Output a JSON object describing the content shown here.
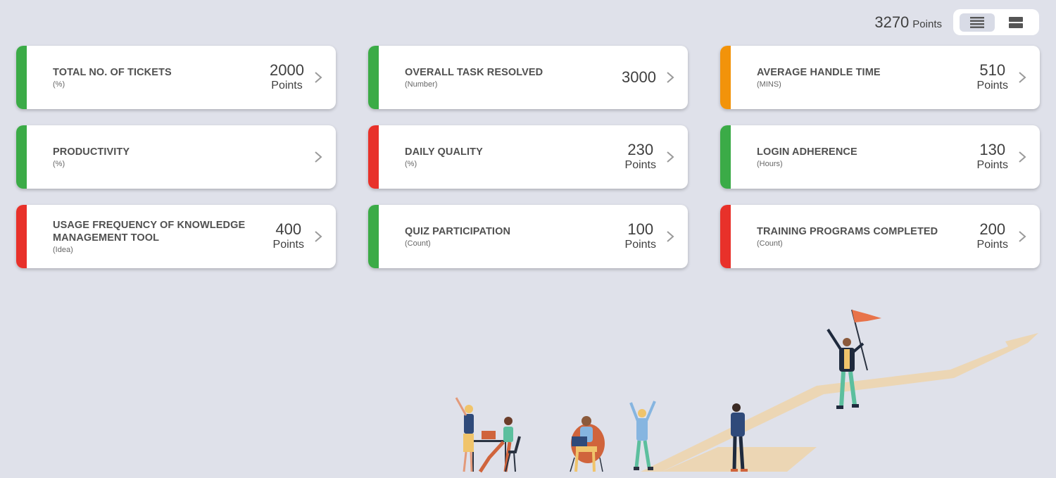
{
  "header": {
    "total_value": "3270",
    "total_unit": "Points",
    "view_toggle": {
      "options": [
        "list-view-icon",
        "card-view-icon"
      ],
      "active": "list-view-icon"
    }
  },
  "status_colors": {
    "green": "#3bab47",
    "red": "#e8312a",
    "orange": "#f2930a"
  },
  "cards": [
    {
      "title": "TOTAL NO. OF TICKETS",
      "subtitle": "(%)",
      "value": "2000",
      "unit": "Points",
      "status": "green"
    },
    {
      "title": "OVERALL TASK RESOLVED",
      "subtitle": "(Number)",
      "value": "3000",
      "unit": "",
      "status": "green"
    },
    {
      "title": "AVERAGE HANDLE TIME",
      "subtitle": "(MINS)",
      "value": "510",
      "unit": "Points",
      "status": "orange"
    },
    {
      "title": "PRODUCTIVITY",
      "subtitle": "(%)",
      "value": "",
      "unit": "",
      "status": "green"
    },
    {
      "title": "DAILY QUALITY",
      "subtitle": "(%)",
      "value": "230",
      "unit": "Points",
      "status": "red"
    },
    {
      "title": "LOGIN ADHERENCE",
      "subtitle": "(Hours)",
      "value": "130",
      "unit": "Points",
      "status": "green"
    },
    {
      "title": "USAGE FREQUENCY OF KNOWLEDGE MANAGEMENT TOOL",
      "subtitle": "(Idea)",
      "value": "400",
      "unit": "Points",
      "status": "red"
    },
    {
      "title": "QUIZ PARTICIPATION",
      "subtitle": "(Count)",
      "value": "100",
      "unit": "Points",
      "status": "green"
    },
    {
      "title": "TRAINING PROGRAMS COMPLETED",
      "subtitle": "(Count)",
      "value": "200",
      "unit": "Points",
      "status": "red"
    }
  ],
  "illustration": {
    "icon": "team-success-illustration"
  }
}
